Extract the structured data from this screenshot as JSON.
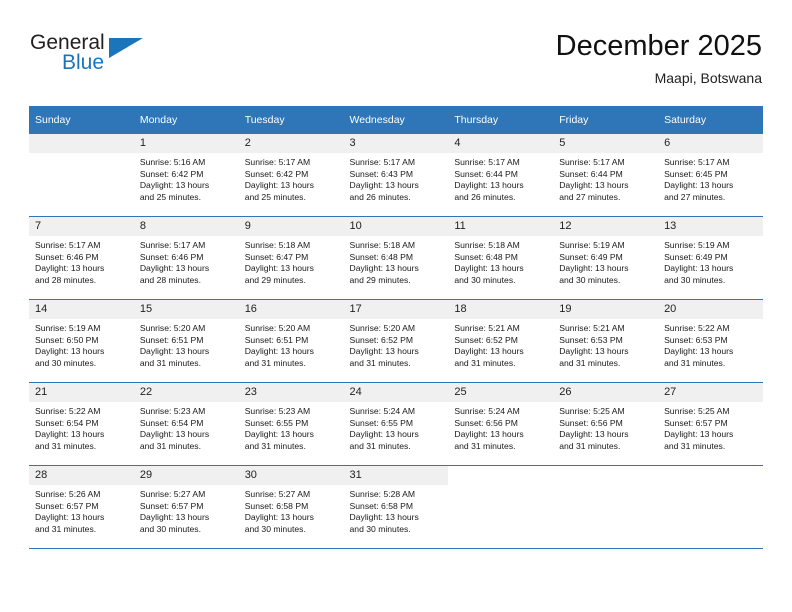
{
  "brand": {
    "name_part1": "General",
    "name_part2": "Blue",
    "logo_icon": "triangle-logo-icon"
  },
  "header": {
    "title": "December 2025",
    "subtitle": "Maapi, Botswana"
  },
  "calendar": {
    "weekday_headers": [
      "Sunday",
      "Monday",
      "Tuesday",
      "Wednesday",
      "Thursday",
      "Friday",
      "Saturday"
    ],
    "accent_color": "#2e76b8",
    "daynum_bg": "#f0f0f0",
    "weeks": [
      [
        {
          "day": "",
          "lines": []
        },
        {
          "day": "1",
          "lines": [
            "Sunrise: 5:16 AM",
            "Sunset: 6:42 PM",
            "Daylight: 13 hours",
            "and 25 minutes."
          ]
        },
        {
          "day": "2",
          "lines": [
            "Sunrise: 5:17 AM",
            "Sunset: 6:42 PM",
            "Daylight: 13 hours",
            "and 25 minutes."
          ]
        },
        {
          "day": "3",
          "lines": [
            "Sunrise: 5:17 AM",
            "Sunset: 6:43 PM",
            "Daylight: 13 hours",
            "and 26 minutes."
          ]
        },
        {
          "day": "4",
          "lines": [
            "Sunrise: 5:17 AM",
            "Sunset: 6:44 PM",
            "Daylight: 13 hours",
            "and 26 minutes."
          ]
        },
        {
          "day": "5",
          "lines": [
            "Sunrise: 5:17 AM",
            "Sunset: 6:44 PM",
            "Daylight: 13 hours",
            "and 27 minutes."
          ]
        },
        {
          "day": "6",
          "lines": [
            "Sunrise: 5:17 AM",
            "Sunset: 6:45 PM",
            "Daylight: 13 hours",
            "and 27 minutes."
          ]
        }
      ],
      [
        {
          "day": "7",
          "lines": [
            "Sunrise: 5:17 AM",
            "Sunset: 6:46 PM",
            "Daylight: 13 hours",
            "and 28 minutes."
          ]
        },
        {
          "day": "8",
          "lines": [
            "Sunrise: 5:17 AM",
            "Sunset: 6:46 PM",
            "Daylight: 13 hours",
            "and 28 minutes."
          ]
        },
        {
          "day": "9",
          "lines": [
            "Sunrise: 5:18 AM",
            "Sunset: 6:47 PM",
            "Daylight: 13 hours",
            "and 29 minutes."
          ]
        },
        {
          "day": "10",
          "lines": [
            "Sunrise: 5:18 AM",
            "Sunset: 6:48 PM",
            "Daylight: 13 hours",
            "and 29 minutes."
          ]
        },
        {
          "day": "11",
          "lines": [
            "Sunrise: 5:18 AM",
            "Sunset: 6:48 PM",
            "Daylight: 13 hours",
            "and 30 minutes."
          ]
        },
        {
          "day": "12",
          "lines": [
            "Sunrise: 5:19 AM",
            "Sunset: 6:49 PM",
            "Daylight: 13 hours",
            "and 30 minutes."
          ]
        },
        {
          "day": "13",
          "lines": [
            "Sunrise: 5:19 AM",
            "Sunset: 6:49 PM",
            "Daylight: 13 hours",
            "and 30 minutes."
          ]
        }
      ],
      [
        {
          "day": "14",
          "lines": [
            "Sunrise: 5:19 AM",
            "Sunset: 6:50 PM",
            "Daylight: 13 hours",
            "and 30 minutes."
          ]
        },
        {
          "day": "15",
          "lines": [
            "Sunrise: 5:20 AM",
            "Sunset: 6:51 PM",
            "Daylight: 13 hours",
            "and 31 minutes."
          ]
        },
        {
          "day": "16",
          "lines": [
            "Sunrise: 5:20 AM",
            "Sunset: 6:51 PM",
            "Daylight: 13 hours",
            "and 31 minutes."
          ]
        },
        {
          "day": "17",
          "lines": [
            "Sunrise: 5:20 AM",
            "Sunset: 6:52 PM",
            "Daylight: 13 hours",
            "and 31 minutes."
          ]
        },
        {
          "day": "18",
          "lines": [
            "Sunrise: 5:21 AM",
            "Sunset: 6:52 PM",
            "Daylight: 13 hours",
            "and 31 minutes."
          ]
        },
        {
          "day": "19",
          "lines": [
            "Sunrise: 5:21 AM",
            "Sunset: 6:53 PM",
            "Daylight: 13 hours",
            "and 31 minutes."
          ]
        },
        {
          "day": "20",
          "lines": [
            "Sunrise: 5:22 AM",
            "Sunset: 6:53 PM",
            "Daylight: 13 hours",
            "and 31 minutes."
          ]
        }
      ],
      [
        {
          "day": "21",
          "lines": [
            "Sunrise: 5:22 AM",
            "Sunset: 6:54 PM",
            "Daylight: 13 hours",
            "and 31 minutes."
          ]
        },
        {
          "day": "22",
          "lines": [
            "Sunrise: 5:23 AM",
            "Sunset: 6:54 PM",
            "Daylight: 13 hours",
            "and 31 minutes."
          ]
        },
        {
          "day": "23",
          "lines": [
            "Sunrise: 5:23 AM",
            "Sunset: 6:55 PM",
            "Daylight: 13 hours",
            "and 31 minutes."
          ]
        },
        {
          "day": "24",
          "lines": [
            "Sunrise: 5:24 AM",
            "Sunset: 6:55 PM",
            "Daylight: 13 hours",
            "and 31 minutes."
          ]
        },
        {
          "day": "25",
          "lines": [
            "Sunrise: 5:24 AM",
            "Sunset: 6:56 PM",
            "Daylight: 13 hours",
            "and 31 minutes."
          ]
        },
        {
          "day": "26",
          "lines": [
            "Sunrise: 5:25 AM",
            "Sunset: 6:56 PM",
            "Daylight: 13 hours",
            "and 31 minutes."
          ]
        },
        {
          "day": "27",
          "lines": [
            "Sunrise: 5:25 AM",
            "Sunset: 6:57 PM",
            "Daylight: 13 hours",
            "and 31 minutes."
          ]
        }
      ],
      [
        {
          "day": "28",
          "lines": [
            "Sunrise: 5:26 AM",
            "Sunset: 6:57 PM",
            "Daylight: 13 hours",
            "and 31 minutes."
          ]
        },
        {
          "day": "29",
          "lines": [
            "Sunrise: 5:27 AM",
            "Sunset: 6:57 PM",
            "Daylight: 13 hours",
            "and 30 minutes."
          ]
        },
        {
          "day": "30",
          "lines": [
            "Sunrise: 5:27 AM",
            "Sunset: 6:58 PM",
            "Daylight: 13 hours",
            "and 30 minutes."
          ]
        },
        {
          "day": "31",
          "lines": [
            "Sunrise: 5:28 AM",
            "Sunset: 6:58 PM",
            "Daylight: 13 hours",
            "and 30 minutes."
          ]
        },
        {
          "day": "",
          "lines": []
        },
        {
          "day": "",
          "lines": []
        },
        {
          "day": "",
          "lines": []
        }
      ]
    ]
  }
}
